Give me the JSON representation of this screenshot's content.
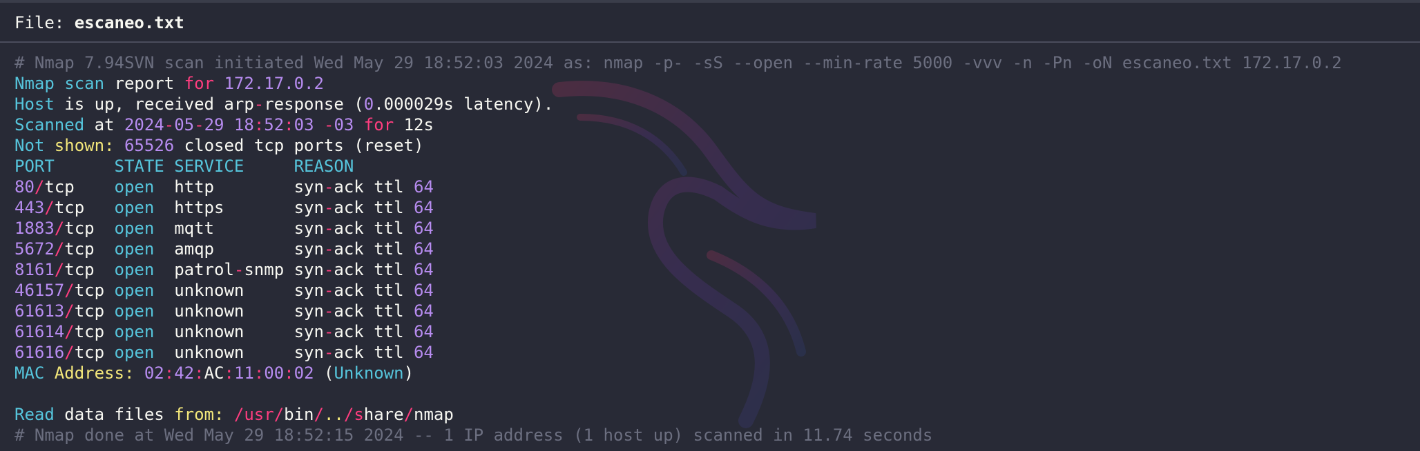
{
  "file_header": {
    "label": "File: ",
    "filename": "escaneo.txt"
  },
  "colors": {
    "background": "#282a36",
    "keyword_cyan": "#56c5dc",
    "operator_pink": "#ff3d7f",
    "number_purple": "#b78cf0",
    "label_yellow": "#f4e87b",
    "comment_gray": "#6c6f80"
  },
  "lines": [
    {
      "name": "comment-scan-initiated",
      "tokens": [
        {
          "t": "# Nmap 7.94SVN scan initiated Wed May 29 18:52:03 2024 as: nmap -p- -sS --open --min-rate 5000 -vvv -n -Pn -oN escaneo.txt 172.17.0.2",
          "c": "comment"
        }
      ]
    },
    {
      "name": "report-line",
      "tokens": [
        {
          "t": "Nmap scan",
          "c": "cyan"
        },
        {
          "t": " report ",
          "c": "white"
        },
        {
          "t": "for",
          "c": "pink"
        },
        {
          "t": " ",
          "c": "white"
        },
        {
          "t": "172.17.0.2",
          "c": "purple"
        }
      ]
    },
    {
      "name": "host-up-line",
      "tokens": [
        {
          "t": "Host",
          "c": "cyan"
        },
        {
          "t": " is up, received arp",
          "c": "white"
        },
        {
          "t": "-",
          "c": "pink"
        },
        {
          "t": "response (",
          "c": "white"
        },
        {
          "t": "0",
          "c": "purple"
        },
        {
          "t": ".000029s latency).",
          "c": "white"
        }
      ]
    },
    {
      "name": "scanned-at-line",
      "tokens": [
        {
          "t": "Scanned",
          "c": "cyan"
        },
        {
          "t": " at ",
          "c": "white"
        },
        {
          "t": "2024",
          "c": "purple"
        },
        {
          "t": "-",
          "c": "pink"
        },
        {
          "t": "05",
          "c": "purple"
        },
        {
          "t": "-",
          "c": "pink"
        },
        {
          "t": "29 18",
          "c": "purple"
        },
        {
          "t": ":",
          "c": "pink"
        },
        {
          "t": "52",
          "c": "purple"
        },
        {
          "t": ":",
          "c": "pink"
        },
        {
          "t": "03",
          "c": "purple"
        },
        {
          "t": " -",
          "c": "pink"
        },
        {
          "t": "03",
          "c": "purple"
        },
        {
          "t": " for",
          "c": "pink"
        },
        {
          "t": " 12s",
          "c": "white"
        }
      ]
    },
    {
      "name": "not-shown-line",
      "tokens": [
        {
          "t": "Not",
          "c": "cyan"
        },
        {
          "t": " shown:",
          "c": "yellow"
        },
        {
          "t": " ",
          "c": "white"
        },
        {
          "t": "65526",
          "c": "purple"
        },
        {
          "t": " closed tcp ports (reset)",
          "c": "white"
        }
      ]
    },
    {
      "name": "table-header-line",
      "tokens": [
        {
          "t": "PORT      STATE SERVICE     REASON",
          "c": "cyan"
        }
      ]
    },
    {
      "name": "port-row-80",
      "tokens": [
        {
          "t": "80",
          "c": "purple"
        },
        {
          "t": "/",
          "c": "pink"
        },
        {
          "t": "tcp    ",
          "c": "white"
        },
        {
          "t": "open",
          "c": "cyan"
        },
        {
          "t": "  http        syn",
          "c": "white"
        },
        {
          "t": "-",
          "c": "pink"
        },
        {
          "t": "ack ttl ",
          "c": "white"
        },
        {
          "t": "64",
          "c": "purple"
        }
      ]
    },
    {
      "name": "port-row-443",
      "tokens": [
        {
          "t": "443",
          "c": "purple"
        },
        {
          "t": "/",
          "c": "pink"
        },
        {
          "t": "tcp   ",
          "c": "white"
        },
        {
          "t": "open",
          "c": "cyan"
        },
        {
          "t": "  https       syn",
          "c": "white"
        },
        {
          "t": "-",
          "c": "pink"
        },
        {
          "t": "ack ttl ",
          "c": "white"
        },
        {
          "t": "64",
          "c": "purple"
        }
      ]
    },
    {
      "name": "port-row-1883",
      "tokens": [
        {
          "t": "1883",
          "c": "purple"
        },
        {
          "t": "/",
          "c": "pink"
        },
        {
          "t": "tcp  ",
          "c": "white"
        },
        {
          "t": "open",
          "c": "cyan"
        },
        {
          "t": "  mqtt        syn",
          "c": "white"
        },
        {
          "t": "-",
          "c": "pink"
        },
        {
          "t": "ack ttl ",
          "c": "white"
        },
        {
          "t": "64",
          "c": "purple"
        }
      ]
    },
    {
      "name": "port-row-5672",
      "tokens": [
        {
          "t": "5672",
          "c": "purple"
        },
        {
          "t": "/",
          "c": "pink"
        },
        {
          "t": "tcp  ",
          "c": "white"
        },
        {
          "t": "open",
          "c": "cyan"
        },
        {
          "t": "  amqp        syn",
          "c": "white"
        },
        {
          "t": "-",
          "c": "pink"
        },
        {
          "t": "ack ttl ",
          "c": "white"
        },
        {
          "t": "64",
          "c": "purple"
        }
      ]
    },
    {
      "name": "port-row-8161",
      "tokens": [
        {
          "t": "8161",
          "c": "purple"
        },
        {
          "t": "/",
          "c": "pink"
        },
        {
          "t": "tcp  ",
          "c": "white"
        },
        {
          "t": "open",
          "c": "cyan"
        },
        {
          "t": "  patrol",
          "c": "white"
        },
        {
          "t": "-",
          "c": "pink"
        },
        {
          "t": "snmp syn",
          "c": "white"
        },
        {
          "t": "-",
          "c": "pink"
        },
        {
          "t": "ack ttl ",
          "c": "white"
        },
        {
          "t": "64",
          "c": "purple"
        }
      ]
    },
    {
      "name": "port-row-46157",
      "tokens": [
        {
          "t": "46157",
          "c": "purple"
        },
        {
          "t": "/",
          "c": "pink"
        },
        {
          "t": "tcp ",
          "c": "white"
        },
        {
          "t": "open",
          "c": "cyan"
        },
        {
          "t": "  unknown     syn",
          "c": "white"
        },
        {
          "t": "-",
          "c": "pink"
        },
        {
          "t": "ack ttl ",
          "c": "white"
        },
        {
          "t": "64",
          "c": "purple"
        }
      ]
    },
    {
      "name": "port-row-61613",
      "tokens": [
        {
          "t": "61613",
          "c": "purple"
        },
        {
          "t": "/",
          "c": "pink"
        },
        {
          "t": "tcp ",
          "c": "white"
        },
        {
          "t": "open",
          "c": "cyan"
        },
        {
          "t": "  unknown     syn",
          "c": "white"
        },
        {
          "t": "-",
          "c": "pink"
        },
        {
          "t": "ack ttl ",
          "c": "white"
        },
        {
          "t": "64",
          "c": "purple"
        }
      ]
    },
    {
      "name": "port-row-61614",
      "tokens": [
        {
          "t": "61614",
          "c": "purple"
        },
        {
          "t": "/",
          "c": "pink"
        },
        {
          "t": "tcp ",
          "c": "white"
        },
        {
          "t": "open",
          "c": "cyan"
        },
        {
          "t": "  unknown     syn",
          "c": "white"
        },
        {
          "t": "-",
          "c": "pink"
        },
        {
          "t": "ack ttl ",
          "c": "white"
        },
        {
          "t": "64",
          "c": "purple"
        }
      ]
    },
    {
      "name": "port-row-61616",
      "tokens": [
        {
          "t": "61616",
          "c": "purple"
        },
        {
          "t": "/",
          "c": "pink"
        },
        {
          "t": "tcp ",
          "c": "white"
        },
        {
          "t": "open",
          "c": "cyan"
        },
        {
          "t": "  unknown     syn",
          "c": "white"
        },
        {
          "t": "-",
          "c": "pink"
        },
        {
          "t": "ack ttl ",
          "c": "white"
        },
        {
          "t": "64",
          "c": "purple"
        }
      ]
    },
    {
      "name": "mac-address-line",
      "tokens": [
        {
          "t": "MAC",
          "c": "cyan"
        },
        {
          "t": " Address:",
          "c": "yellow"
        },
        {
          "t": " ",
          "c": "white"
        },
        {
          "t": "02",
          "c": "purple"
        },
        {
          "t": ":",
          "c": "pink"
        },
        {
          "t": "42",
          "c": "purple"
        },
        {
          "t": ":",
          "c": "pink"
        },
        {
          "t": "AC",
          "c": "white"
        },
        {
          "t": ":",
          "c": "pink"
        },
        {
          "t": "11",
          "c": "purple"
        },
        {
          "t": ":",
          "c": "pink"
        },
        {
          "t": "00",
          "c": "purple"
        },
        {
          "t": ":",
          "c": "pink"
        },
        {
          "t": "02",
          "c": "purple"
        },
        {
          "t": " (",
          "c": "white"
        },
        {
          "t": "Unknown",
          "c": "cyan"
        },
        {
          "t": ")",
          "c": "white"
        }
      ]
    },
    {
      "name": "blank-line",
      "tokens": []
    },
    {
      "name": "read-data-files-line",
      "tokens": [
        {
          "t": "Read",
          "c": "cyan"
        },
        {
          "t": " data files ",
          "c": "white"
        },
        {
          "t": "from:",
          "c": "yellow"
        },
        {
          "t": " ",
          "c": "white"
        },
        {
          "t": "/",
          "c": "pink"
        },
        {
          "t": "usr",
          "c": "pink"
        },
        {
          "t": "/",
          "c": "pink"
        },
        {
          "t": "bin",
          "c": "white"
        },
        {
          "t": "/",
          "c": "pink"
        },
        {
          "t": "..",
          "c": "yellow"
        },
        {
          "t": "/",
          "c": "pink"
        },
        {
          "t": "s",
          "c": "pink"
        },
        {
          "t": "hare",
          "c": "white"
        },
        {
          "t": "/",
          "c": "pink"
        },
        {
          "t": "nmap",
          "c": "white"
        }
      ]
    },
    {
      "name": "comment-scan-done",
      "tokens": [
        {
          "t": "# Nmap done at Wed May 29 18:52:15 2024 -- 1 IP address (1 host up) scanned in 11.74 seconds",
          "c": "comment"
        }
      ]
    }
  ]
}
